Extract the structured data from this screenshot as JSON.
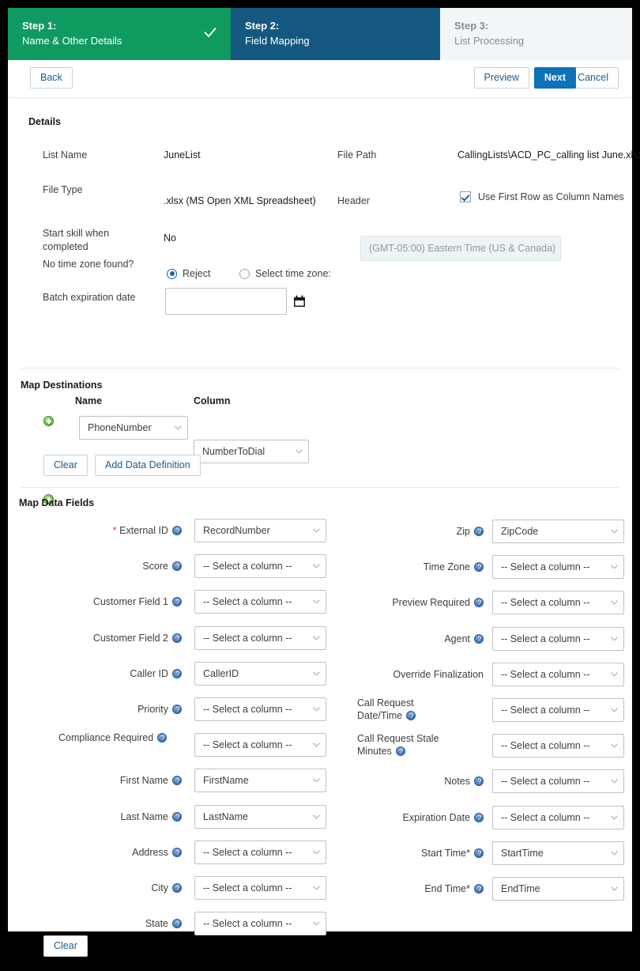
{
  "steps": [
    {
      "num": "Step 1:",
      "name": "Name & Other Details",
      "state": "done",
      "icon": "check-icon"
    },
    {
      "num": "Step 2:",
      "name": "Field Mapping",
      "state": "current"
    },
    {
      "num": "Step 3:",
      "name": "List Processing",
      "state": "todo"
    }
  ],
  "toolbar": {
    "back": "Back",
    "preview": "Preview",
    "next": "Next",
    "cancel": "Cancel"
  },
  "details": {
    "title": "Details",
    "list_name_label": "List Name",
    "list_name_value": "JuneList",
    "file_path_label": "File Path",
    "file_path_value": "CallingLists\\ACD_PC_calling list June.xlsx",
    "file_type_label": "File Type",
    "file_type_value": ".xlsx (MS Open XML Spreadsheet)",
    "header_label": "Header",
    "header_checkbox_label": "Use First Row as Column Names",
    "header_checkbox_checked": true,
    "start_skill_label": "Start skill when completed",
    "start_skill_value": "No",
    "no_tz_label": "No time zone found?",
    "radio_reject": "Reject",
    "radio_select_tz": "Select time zone:",
    "radio_selected": "Reject",
    "timezone_value": "(GMT-05:00) Eastern Time (US & Canada)",
    "batch_expiration_label": "Batch expiration date",
    "batch_expiration_value": "",
    "calendar_icon": "calendar-icon"
  },
  "map_destinations": {
    "title": "Map Destinations",
    "col_name": "Name",
    "col_column": "Column",
    "rows": [
      {
        "name": "PhoneNumber",
        "column": "NumberToDial"
      }
    ],
    "clear": "Clear",
    "add_data_definition": "Add Data Definition"
  },
  "map_data_fields": {
    "title": "Map Data Fields",
    "placeholder": "-- Select a column --",
    "clear": "Clear",
    "left": [
      {
        "label": "External ID",
        "value": "RecordNumber",
        "required": true,
        "help": true
      },
      {
        "label": "Score",
        "value": "-- Select a column --",
        "required": false,
        "help": true
      },
      {
        "label": "Customer Field 1",
        "value": "-- Select a column --",
        "required": false,
        "help": true
      },
      {
        "label": "Customer Field 2",
        "value": "-- Select a column --",
        "required": false,
        "help": true
      },
      {
        "label": "Caller ID",
        "value": "CallerID",
        "required": false,
        "help": true
      },
      {
        "label": "Priority",
        "value": "-- Select a column --",
        "required": false,
        "help": true
      },
      {
        "label": "Compliance Required",
        "value": "-- Select a column --",
        "required": false,
        "help": true
      },
      {
        "label": "First Name",
        "value": "FirstName",
        "required": false,
        "help": true
      },
      {
        "label": "Last Name",
        "value": "LastName",
        "required": false,
        "help": true
      },
      {
        "label": "Address",
        "value": "-- Select a column --",
        "required": false,
        "help": true
      },
      {
        "label": "City",
        "value": "-- Select a column --",
        "required": false,
        "help": true
      },
      {
        "label": "State",
        "value": "-- Select a column --",
        "required": false,
        "help": true
      }
    ],
    "right": [
      {
        "label": "Zip",
        "value": "ZipCode",
        "help": true
      },
      {
        "label": "Time Zone",
        "value": "-- Select a column --",
        "help": true
      },
      {
        "label": "Preview Required",
        "value": "-- Select a column --",
        "help": true
      },
      {
        "label": "Agent",
        "value": "-- Select a column --",
        "help": true
      },
      {
        "label": "Override Finalization",
        "value": "-- Select a column --",
        "help": false
      },
      {
        "label": "Call Request Date/Time",
        "value": "-- Select a column --",
        "help": true
      },
      {
        "label": "Call Request Stale Minutes",
        "value": "-- Select a column --",
        "help": true
      },
      {
        "label": "Notes",
        "value": "-- Select a column --",
        "help": true
      },
      {
        "label": "Expiration Date",
        "value": "-- Select a column --",
        "help": true
      },
      {
        "label": "Start Time*",
        "value": "StartTime",
        "help": true
      },
      {
        "label": "End Time*",
        "value": "EndTime",
        "help": true
      }
    ]
  },
  "colors": {
    "step_done": "#0f9b60",
    "step_current": "#14587f",
    "step_todo_bg": "#f2f6f8",
    "primary_button": "#0d72b9",
    "link_text": "#1a5b8e",
    "required_star": "#e23d3d"
  }
}
